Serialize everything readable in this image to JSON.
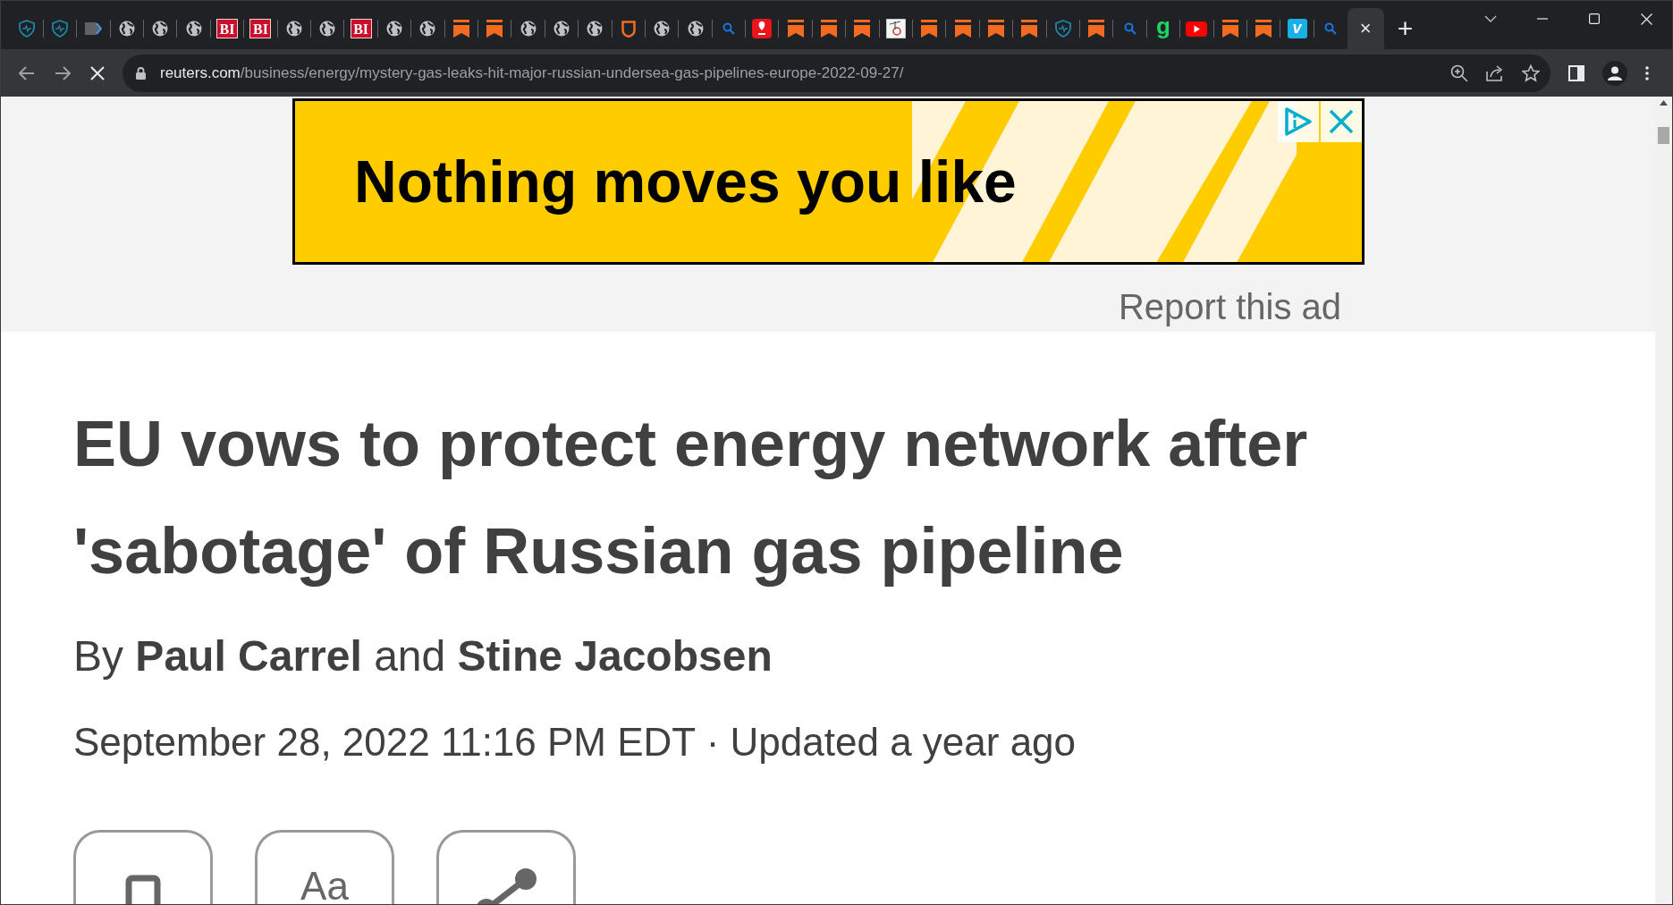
{
  "tabs": [
    {
      "kind": "shield",
      "selected": false
    },
    {
      "kind": "shield",
      "selected": false
    },
    {
      "kind": "tag",
      "selected": false
    },
    {
      "kind": "globe",
      "selected": false
    },
    {
      "kind": "globe",
      "selected": false
    },
    {
      "kind": "globe",
      "selected": false
    },
    {
      "kind": "letters",
      "text": "BI",
      "selected": false
    },
    {
      "kind": "letters",
      "text": "BI",
      "selected": false
    },
    {
      "kind": "globe",
      "selected": false
    },
    {
      "kind": "globe",
      "selected": false
    },
    {
      "kind": "letters",
      "text": "BI",
      "selected": false
    },
    {
      "kind": "globe",
      "selected": false
    },
    {
      "kind": "globe",
      "selected": false
    },
    {
      "kind": "bookmark",
      "selected": false
    },
    {
      "kind": "bookmark",
      "selected": false
    },
    {
      "kind": "globe",
      "selected": false
    },
    {
      "kind": "globe",
      "selected": false
    },
    {
      "kind": "globe",
      "selected": false
    },
    {
      "kind": "badge",
      "selected": false
    },
    {
      "kind": "globe",
      "selected": false
    },
    {
      "kind": "globe",
      "selected": false
    },
    {
      "kind": "search",
      "selected": false
    },
    {
      "kind": "pin",
      "selected": false
    },
    {
      "kind": "bookmark",
      "selected": false
    },
    {
      "kind": "bookmark",
      "selected": false
    },
    {
      "kind": "bookmark",
      "selected": false
    },
    {
      "kind": "image",
      "selected": false
    },
    {
      "kind": "bookmark",
      "selected": false
    },
    {
      "kind": "bookmark",
      "selected": false
    },
    {
      "kind": "bookmark",
      "selected": false
    },
    {
      "kind": "bookmark",
      "selected": false
    },
    {
      "kind": "shield",
      "selected": false
    },
    {
      "kind": "bookmark",
      "selected": false
    },
    {
      "kind": "search",
      "selected": false
    },
    {
      "kind": "green-letter",
      "text": "g",
      "selected": false
    },
    {
      "kind": "play",
      "selected": false
    },
    {
      "kind": "bookmark",
      "selected": false
    },
    {
      "kind": "bookmark",
      "selected": false
    },
    {
      "kind": "blue-letter",
      "text": "v",
      "selected": false
    },
    {
      "kind": "search",
      "selected": false
    },
    {
      "kind": "blank",
      "close": "×",
      "selected": true
    }
  ],
  "new_tab": "+",
  "toolbar": {
    "loading": true,
    "url_domain": "reuters.com",
    "url_path": "/business/energy/mystery-gas-leaks-hit-major-russian-undersea-gas-pipelines-europe-2022-09-27/"
  },
  "ad": {
    "headline": "Nothing moves you like",
    "report": "Report this ad"
  },
  "article": {
    "headline": "EU vows to protect energy network after 'sabotage' of Russian gas pipeline",
    "byline": "By **Paul Carrel** and **Stine Jacobsen**",
    "dateline": "September 28, 2022 11:16 PM EDT · Updated a year ago",
    "tools": [
      {
        "kind": "device"
      },
      {
        "kind": "text-size",
        "label": "Aa"
      },
      {
        "kind": "share"
      }
    ]
  }
}
